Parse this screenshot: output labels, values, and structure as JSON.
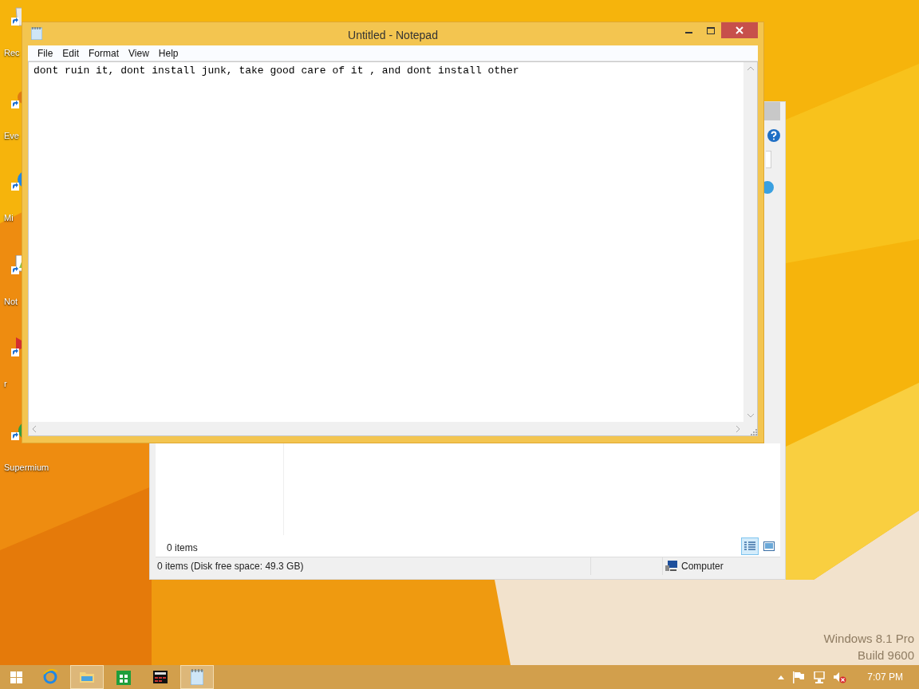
{
  "desktop_icons": [
    {
      "kind": "recycle",
      "label": "Rec"
    },
    {
      "kind": "shortcut",
      "label": "Eve"
    },
    {
      "kind": "globe",
      "label": "Mi"
    },
    {
      "kind": "document",
      "label": "Not"
    },
    {
      "kind": "play",
      "label": "r"
    },
    {
      "kind": "browser",
      "label": "Supermium"
    }
  ],
  "explorer": {
    "items_count": "0 items",
    "status_text": "0 items (Disk free space: 49.3 GB)",
    "location": "Computer",
    "views": [
      {
        "kind": "details",
        "selected": true
      },
      {
        "kind": "thumbnails",
        "selected": false
      }
    ]
  },
  "notepad": {
    "title": "Untitled - Notepad",
    "menu": [
      "File",
      "Edit",
      "Format",
      "View",
      "Help"
    ],
    "text": "dont ruin it, dont install junk, take good care of it , and dont install other"
  },
  "watermark": [
    "Windows 8.1 Pro",
    "Build 9600"
  ],
  "taskbar": {
    "apps": [
      {
        "kind": "ie",
        "open": false
      },
      {
        "kind": "explorer",
        "open": true
      },
      {
        "kind": "store",
        "open": false
      },
      {
        "kind": "startapp",
        "open": false
      },
      {
        "kind": "notepad",
        "open": true
      }
    ],
    "clock": "7:07 PM"
  }
}
